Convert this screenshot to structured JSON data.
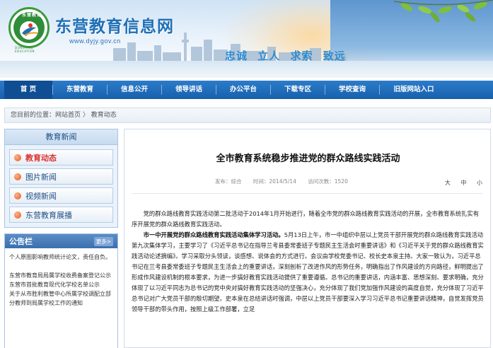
{
  "site": {
    "logo_top": "东营教育",
    "logo_bottom": "DONGYING EDUCATION",
    "title": "东营教育信息网",
    "url": "www.dyjy.gov.cn",
    "motto": [
      "忠诚",
      "立人",
      "求索",
      "致远"
    ]
  },
  "nav": {
    "items": [
      "首 页",
      "东营教育",
      "信息公开",
      "领导讲话",
      "办公平台",
      "下载专区",
      "学校查询",
      "旧版网站入口"
    ],
    "active_index": 0
  },
  "breadcrumb": "您目前的位置：网站首页 〉 教育动态",
  "sidebar": {
    "title": "教育新闻",
    "items": [
      "教育动态",
      "图片新闻",
      "视频新闻",
      "东营教育展播"
    ],
    "active_index": 0
  },
  "notice": {
    "title": "公告栏",
    "more": "更多>",
    "items": [
      "个人原图影响教师统计论文，责任自负。",
      "东营市教育局局属学校收费备案登记公示",
      "东营市首批教育现代化学校名单公示",
      "关于从市胜利教管中心所属学校调配立部分教师到局属学校工作的通知"
    ]
  },
  "article": {
    "title": "全市教育系统稳步推进党的群众路线实践活动",
    "author": "发布：综合",
    "date": "时间：2014/5/14",
    "views": "访问次数：1520",
    "font_size": [
      "大",
      "中",
      "小"
    ],
    "para1": "党的群众路线教育实践活动第二批活动于2014年1月开始进行，随着全市党的群众路线教育实践活动的开展，全市教育系统扎实有序开展党的群众路线教育实践活动。",
    "para2_bold": "市一中开展党的群众路线教育实践活动集体学习活动。",
    "para2": "5月13日上午，市一中组织中层以上党员干部开展党的群众路线教育实践活动第九次集体学习，主要学习了《习近平总书记在指导兰考县委常委班子专题民主生活会时重要讲话》和《习近平关于党的群众路线教育实践活动论述摘编》。学习采取分头领读，谈感想、说体会的方式进行。会议由学校党委书记、校长史本泉主持。大家一致认为，习近平总书记在兰考县委常委班子专题民主生活会上的重要讲话，深刻剖析了改进作风的形势任务，明确指出了作风建设的方向路径，鲜明提出了形成作风建设机制的根本要求，为进一步搞好教育实践活动提供了重要遵循。总书记的重要讲话，内涵丰富、思想深刻、要求明确，充分体现了以习近平同志为总书记的党中央对搞好教育实践活动的坚强决心，充分体现了我们党加强作风建设的高度自觉，充分体现了习近平总书记对广大党员干部的殷切期望。史本泉在总结讲话时强调，中层以上党员干部要深入学习习近平总书记重要讲话精神，自觉发挥党员领导干部的带头作用，按照上级工作部署，立足"
  }
}
